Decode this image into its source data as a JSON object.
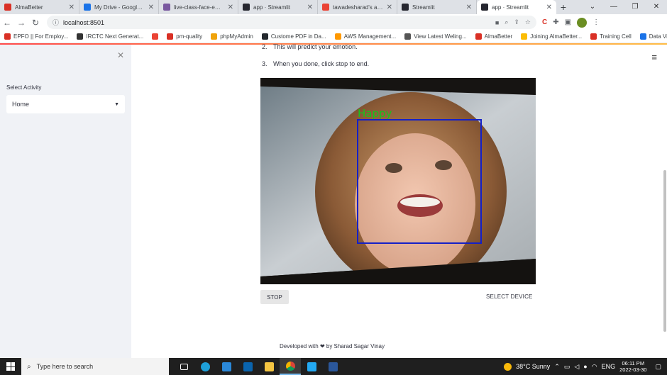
{
  "browser": {
    "tabs": [
      {
        "title": "AlmaBetter",
        "icon": "almabetter-icon",
        "color": "#d93025",
        "active": false
      },
      {
        "title": "My Drive - Google Drive",
        "icon": "google-drive-icon",
        "color": "#1a73e8",
        "active": false
      },
      {
        "title": "live-class-face-emotion",
        "icon": "heroku-icon",
        "color": "#79589f",
        "active": false
      },
      {
        "title": "app · Streamlit",
        "icon": "streamlit-icon",
        "color": "#262730",
        "active": false
      },
      {
        "title": "tawadesharad's apps",
        "icon": "gmail-icon",
        "color": "#ea4335",
        "active": false
      },
      {
        "title": "Streamlit",
        "icon": "streamlit-icon",
        "color": "#262730",
        "active": false
      },
      {
        "title": "app · Streamlit",
        "icon": "streamlit-icon",
        "color": "#262730",
        "active": true
      }
    ],
    "new_tab": "+",
    "url": "localhost:8501",
    "bookmarks": [
      {
        "label": "EPFO || For Employ...",
        "color": "#d93025"
      },
      {
        "label": "IRCTC Next Generat...",
        "color": "#333333"
      },
      {
        "label": "",
        "color": "#ea4335"
      },
      {
        "label": "pm-quality",
        "color": "#d93025"
      },
      {
        "label": "phpMyAdmin",
        "color": "#f0a30a"
      },
      {
        "label": "Custome PDF in Da...",
        "color": "#24292e"
      },
      {
        "label": "AWS Management...",
        "color": "#ff9900"
      },
      {
        "label": "View Latest Weling...",
        "color": "#555555"
      },
      {
        "label": "AlmaBetter",
        "color": "#d93025"
      },
      {
        "label": "Joining AlmaBetter...",
        "color": "#fbbc04"
      },
      {
        "label": "Training Cell",
        "color": "#d93025"
      },
      {
        "label": "Data Visualization...",
        "color": "#1a73e8"
      }
    ],
    "bookmarks_more": "»"
  },
  "sidebar": {
    "select_label": "Select Activity",
    "selected_value": "Home"
  },
  "main": {
    "steps": [
      {
        "num": "2.",
        "text": "This will predict your emotion."
      },
      {
        "num": "3.",
        "text": "When you done, click stop to end."
      }
    ],
    "emotion_label": "Happy",
    "stop_label": "STOP",
    "select_device_label": "SELECT DEVICE",
    "footer_prefix": "Developed with",
    "footer_heart": "❤",
    "footer_suffix": "by Sharad Sagar Vinay",
    "colors": {
      "detection_box": "#1420c8",
      "emotion_text": "#17c41b",
      "sidebar_bg": "#f0f2f6"
    }
  },
  "taskbar": {
    "search_placeholder": "Type here to search",
    "weather": "38°C  Sunny",
    "language": "ENG",
    "time": "06:11 PM",
    "date": "2022-03-30"
  }
}
